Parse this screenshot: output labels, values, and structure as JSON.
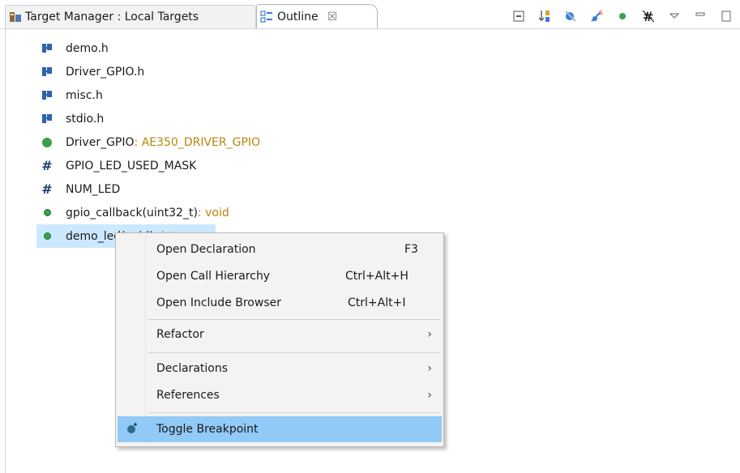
{
  "tabs": {
    "target_manager": "Target Manager : Local Targets",
    "outline": "Outline",
    "close_glyph": "☒"
  },
  "toolbar": {
    "icons": [
      "collapse-all-icon",
      "sort-icon",
      "hide-fields-icon",
      "hide-static-icon",
      "hide-non-public-icon",
      "hide-macros-icon",
      "view-menu-icon",
      "minimize-icon",
      "maximize-icon"
    ]
  },
  "tree": {
    "items": [
      {
        "kind": "header",
        "name": "demo.h"
      },
      {
        "kind": "header",
        "name": "Driver_GPIO.h"
      },
      {
        "kind": "header",
        "name": "misc.h"
      },
      {
        "kind": "header",
        "name": "stdio.h"
      },
      {
        "kind": "variable",
        "name": "Driver_GPIO",
        "type": " : AE350_DRIVER_GPIO"
      },
      {
        "kind": "macro",
        "name": "GPIO_LED_USED_MASK"
      },
      {
        "kind": "macro",
        "name": "NUM_LED"
      },
      {
        "kind": "function",
        "name": "gpio_callback(uint32_t)",
        "type": " : void"
      },
      {
        "kind": "function",
        "name": "demo_led(void)",
        "type": " : int"
      }
    ]
  },
  "context_menu": {
    "open_declaration": {
      "label": "Open Declaration",
      "shortcut": "F3"
    },
    "open_call_hierarchy": {
      "label": "Open Call Hierarchy",
      "shortcut": "Ctrl+Alt+H"
    },
    "open_include_browser": {
      "label": "Open Include Browser",
      "shortcut": "Ctrl+Alt+I"
    },
    "refactor": {
      "label": "Refactor",
      "arrow": "›"
    },
    "declarations": {
      "label": "Declarations",
      "arrow": "›"
    },
    "references": {
      "label": "References",
      "arrow": "›"
    },
    "toggle_breakpoint": {
      "label": "Toggle Breakpoint"
    }
  },
  "colors": {
    "selection": "#cce8ff",
    "menu_highlight": "#91c9f7",
    "type_text": "#b8860b",
    "header_icon": "#2e64a8",
    "function_icon": "#3aa04b"
  }
}
